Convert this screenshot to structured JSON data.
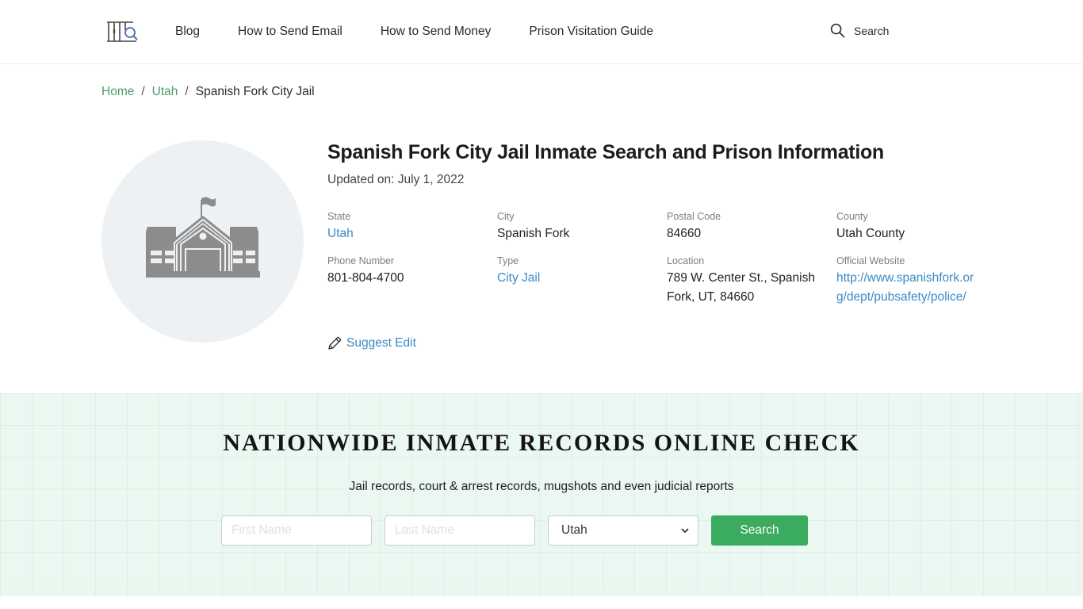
{
  "header": {
    "logo_icon": "jail-bars-magnifier-icon",
    "nav": [
      {
        "label": "Blog"
      },
      {
        "label": "How to Send Email"
      },
      {
        "label": "How to Send Money"
      },
      {
        "label": "Prison Visitation Guide"
      }
    ],
    "search_icon": "search-icon",
    "search_label": "Search"
  },
  "breadcrumb": {
    "items": [
      {
        "label": "Home",
        "link": true
      },
      {
        "label": "Utah",
        "link": true
      },
      {
        "label": "Spanish Fork City Jail",
        "link": false
      }
    ],
    "separator": "/"
  },
  "facility": {
    "image_icon": "building-with-flag-icon",
    "title": "Spanish Fork City Jail Inmate Search and Prison Information",
    "updated": "Updated on: July 1, 2022",
    "fields": [
      {
        "label": "State",
        "value": "Utah",
        "link": true
      },
      {
        "label": "City",
        "value": "Spanish Fork",
        "link": false
      },
      {
        "label": "Postal Code",
        "value": "84660",
        "link": false
      },
      {
        "label": "County",
        "value": "Utah County",
        "link": false
      },
      {
        "label": "Phone Number",
        "value": "801-804-4700",
        "link": false
      },
      {
        "label": "Type",
        "value": "City Jail",
        "link": true
      },
      {
        "label": "Location",
        "value": "789 W. Center St., Spanish Fork, UT, 84660",
        "link": false
      },
      {
        "label": "Official Website",
        "value": "http://www.spanishfork.org/dept/pubsafety/police/",
        "link": true
      }
    ],
    "suggest_edit_icon": "pencil-icon",
    "suggest_edit_label": "Suggest Edit"
  },
  "search_band": {
    "title": "NATIONWIDE INMATE RECORDS ONLINE CHECK",
    "subtitle": "Jail records, court & arrest records, mugshots and even judicial reports",
    "first_name_placeholder": "First Name",
    "first_name_value": "",
    "last_name_placeholder": "Last Name",
    "last_name_value": "",
    "state_selected": "Utah",
    "button_label": "Search",
    "colors": {
      "background": "#ebf8f1",
      "button": "#3aab5f"
    }
  },
  "colors": {
    "breadcrumb_link": "#4e9a6a",
    "info_link": "#3b8ac4"
  }
}
